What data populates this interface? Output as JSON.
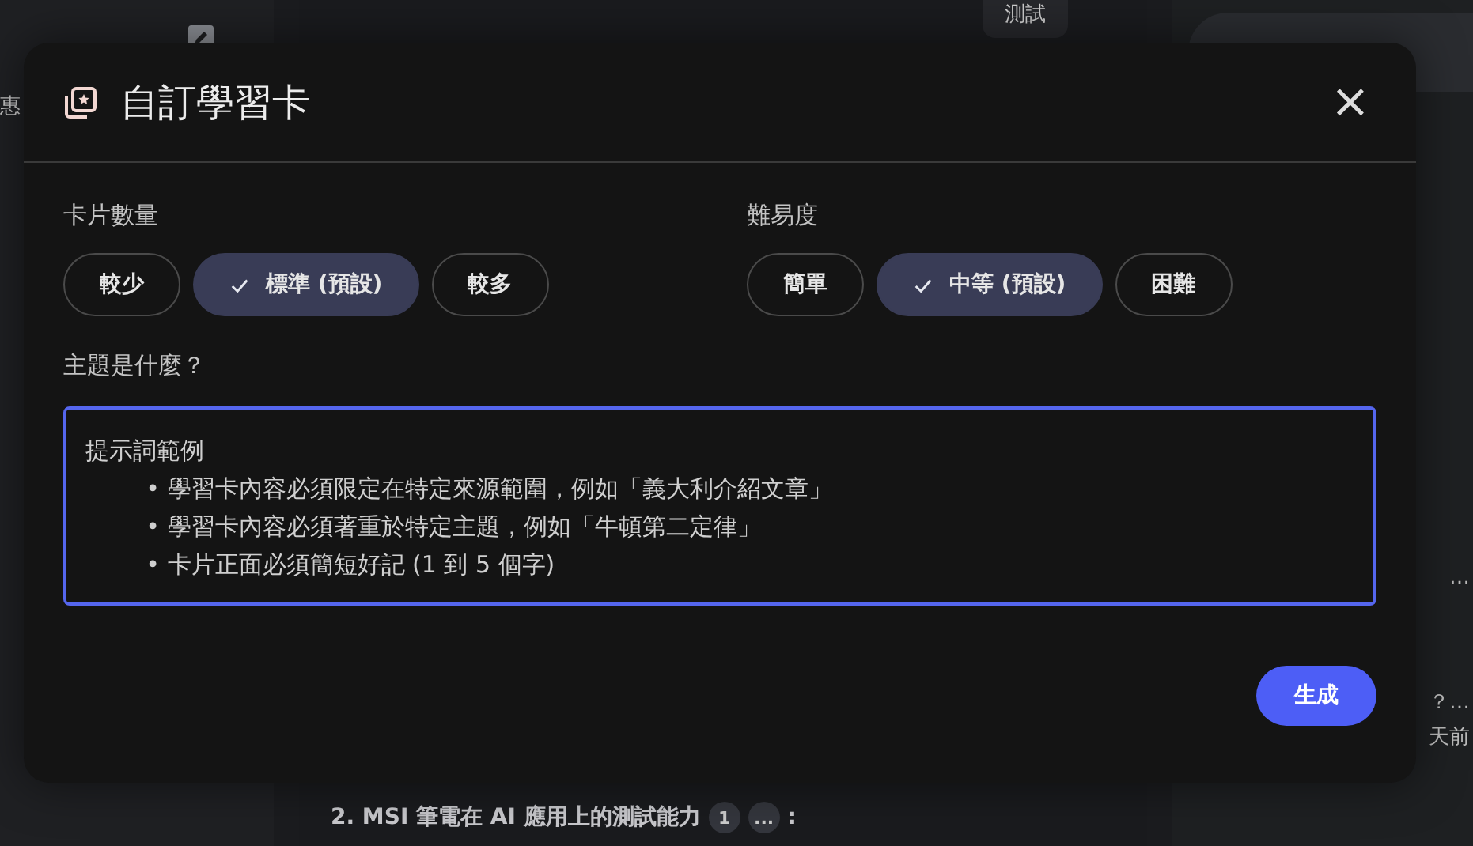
{
  "background": {
    "side_text": "惠",
    "top_chip": "測試",
    "right_snippets": [
      "…",
      "？…",
      "天前"
    ],
    "list_item": {
      "text": "2. MSI 筆電在 AI 應用上的測試能力",
      "citations": [
        "1",
        "..."
      ],
      "suffix": ":"
    }
  },
  "dialog": {
    "title": "自訂學習卡",
    "close": "×",
    "groups": [
      {
        "label": "卡片數量",
        "options": [
          {
            "label": "較少",
            "selected": false
          },
          {
            "label": "標準 (預設)",
            "selected": true
          },
          {
            "label": "較多",
            "selected": false
          }
        ]
      },
      {
        "label": "難易度",
        "options": [
          {
            "label": "簡單",
            "selected": false
          },
          {
            "label": "中等 (預設)",
            "selected": true
          },
          {
            "label": "困難",
            "selected": false
          }
        ]
      }
    ],
    "topic_label": "主題是什麼？",
    "topic_field": {
      "placeholder": "提示詞範例\n        • 學習卡內容必須限定在特定來源範圍，例如「義大利介紹文章」\n        • 學習卡內容必須著重於特定主題，例如「牛頓第二定律」\n        • 卡片正面必須簡短好記 (1 到 5 個字)"
    },
    "generate_button": "生成"
  }
}
